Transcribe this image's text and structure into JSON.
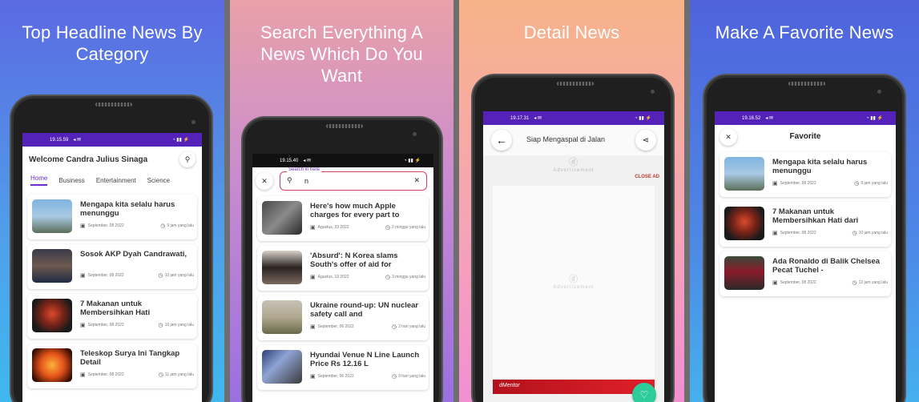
{
  "panels": [
    {
      "title": "Top Headline News By Category"
    },
    {
      "title": "Search Everything A News Which Do You Want"
    },
    {
      "title": "Detail News"
    },
    {
      "title": "Make A Favorite News"
    }
  ],
  "colors": {
    "accent": "#5422b8",
    "tab_active": "#6a2fd0",
    "close_ad": "#c0392b",
    "fab": "#2ecc9a"
  },
  "home": {
    "status_time": "19.15.59",
    "welcome": "Welcome Candra Julius Sinaga",
    "tabs": [
      "Home",
      "Business",
      "Entertainment",
      "Science"
    ],
    "items": [
      {
        "title": "Mengapa kita selalu harus menunggu",
        "date": "September, 08 2022",
        "ago": "9 jam yang lalu"
      },
      {
        "title": "Sosok AKP Dyah Candrawati,",
        "date": "September, 08 2022",
        "ago": "10 jam yang lalu"
      },
      {
        "title": "7 Makanan untuk Membersihkan Hati",
        "date": "September, 08 2022",
        "ago": "10 jam yang lalu"
      },
      {
        "title": "Teleskop Surya Ini Tangkap Detail",
        "date": "September, 08 2022",
        "ago": "11 jam yang lalu"
      }
    ]
  },
  "search": {
    "status_time": "19.15.40",
    "label": "Search in here",
    "query": "n",
    "items": [
      {
        "title": "Here's how much Apple charges for every part to",
        "date": "Agustus, 23 2022",
        "ago": "2 minggu yang lalu"
      },
      {
        "title": "'Absurd': N Korea slams South's offer of aid for",
        "date": "Agustus, 19 2022",
        "ago": "3 minggu yang lalu"
      },
      {
        "title": "Ukraine round-up: UN nuclear safety call and",
        "date": "September, 06 2022",
        "ago": "2 hari yang lalu"
      },
      {
        "title": "Hyundai Venue N Line Launch Price Rs 12.16 L",
        "date": "September, 06 2022",
        "ago": "3 hari yang lalu"
      }
    ]
  },
  "detail": {
    "status_time": "19.17.31",
    "header_title": "Siap Mengaspal di Jalan",
    "ad_label": "Advertisement",
    "close_ad": "CLOSE AD",
    "ad_brand": "dMentor"
  },
  "favorite": {
    "status_time": "19.16.52",
    "title": "Favorite",
    "items": [
      {
        "title": "Mengapa kita selalu harus menunggu",
        "date": "September, 08 2022",
        "ago": "9 jam yang lalu"
      },
      {
        "title": "7 Makanan untuk Membersihkan Hati dari",
        "date": "September, 08 2022",
        "ago": "10 jam yang lalu"
      },
      {
        "title": "Ada Ronaldo di Balik Chelsea Pecat Tuchel -",
        "date": "September, 08 2022",
        "ago": "12 jam yang lalu"
      }
    ]
  }
}
